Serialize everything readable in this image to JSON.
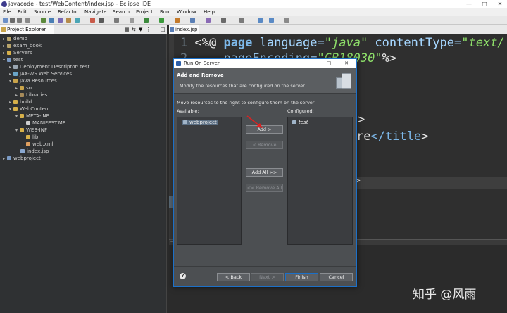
{
  "window": {
    "title": "javacode - test/WebContent/index.jsp - Eclipse IDE"
  },
  "menu": [
    "File",
    "Edit",
    "Source",
    "Refactor",
    "Navigate",
    "Search",
    "Project",
    "Run",
    "Window",
    "Help"
  ],
  "explorer": {
    "title": "Project Explorer",
    "items": [
      {
        "label": "demo",
        "depth": 0,
        "expanded": false,
        "icon": "project-icon"
      },
      {
        "label": "exam_book",
        "depth": 0,
        "expanded": false,
        "icon": "project-icon"
      },
      {
        "label": "Servers",
        "depth": 0,
        "expanded": false,
        "icon": "folder-icon"
      },
      {
        "label": "test",
        "depth": 0,
        "expanded": true,
        "icon": "web-project-icon"
      },
      {
        "label": "Deployment Descriptor: test",
        "depth": 1,
        "expanded": false,
        "icon": "descriptor-icon"
      },
      {
        "label": "JAX-WS Web Services",
        "depth": 1,
        "expanded": false,
        "icon": "webservice-icon"
      },
      {
        "label": "Java Resources",
        "depth": 1,
        "expanded": true,
        "icon": "java-resources-icon"
      },
      {
        "label": "src",
        "depth": 2,
        "expanded": false,
        "icon": "package-icon"
      },
      {
        "label": "Libraries",
        "depth": 2,
        "expanded": false,
        "icon": "library-icon"
      },
      {
        "label": "build",
        "depth": 1,
        "expanded": false,
        "icon": "folder-icon"
      },
      {
        "label": "WebContent",
        "depth": 1,
        "expanded": true,
        "icon": "folder-icon"
      },
      {
        "label": "META-INF",
        "depth": 2,
        "expanded": true,
        "icon": "folder-icon"
      },
      {
        "label": "MANIFEST.MF",
        "depth": 3,
        "expanded": null,
        "icon": "file-icon"
      },
      {
        "label": "WEB-INF",
        "depth": 2,
        "expanded": true,
        "icon": "folder-icon"
      },
      {
        "label": "lib",
        "depth": 3,
        "expanded": null,
        "icon": "folder-icon"
      },
      {
        "label": "web.xml",
        "depth": 3,
        "expanded": null,
        "icon": "xml-file-icon"
      },
      {
        "label": "index.jsp",
        "depth": 2,
        "expanded": null,
        "icon": "jsp-file-icon"
      },
      {
        "label": "webproject",
        "depth": 0,
        "expanded": false,
        "icon": "web-project-icon"
      }
    ]
  },
  "editor": {
    "tab": "index.jsp",
    "line1_num": "1",
    "line1_open": "<%@ ",
    "line1_kw": "page",
    "line1_attr1": " language=",
    "line1_val1": "\"java\"",
    "line1_attr2": " contentType=",
    "line1_val2": "\"text/",
    "line2_num": "2",
    "line2_attr": "    pageEncoding=",
    "line2_val": "\"GB18030\"",
    "line2_close": "%>",
    "frag1": ">",
    "frag2_text": "re",
    "frag2_tag": "</title",
    "frag2_close": ">",
    "frag3": ">"
  },
  "dialog": {
    "title": "Run On Server",
    "heading": "Add and Remove",
    "description": "Modify the resources that are configured on the server",
    "instruction": "Move resources to the right to configure them on the server",
    "available_label": "Available:",
    "configured_label": "Configured:",
    "available_items": [
      "webproject"
    ],
    "configured_items": [
      "test"
    ],
    "buttons": {
      "add": "Add >",
      "remove": "< Remove",
      "add_all": "Add All >>",
      "remove_all": "<< Remove All",
      "back": "< Back",
      "next": "Next >",
      "finish": "Finish",
      "cancel": "Cancel"
    },
    "help_glyph": "?"
  },
  "watermark": "知乎 @风雨",
  "colors": {
    "accent_blue": "#1c70c8",
    "annotation_red": "#e02020",
    "editor_bg": "#2f2f2f"
  }
}
